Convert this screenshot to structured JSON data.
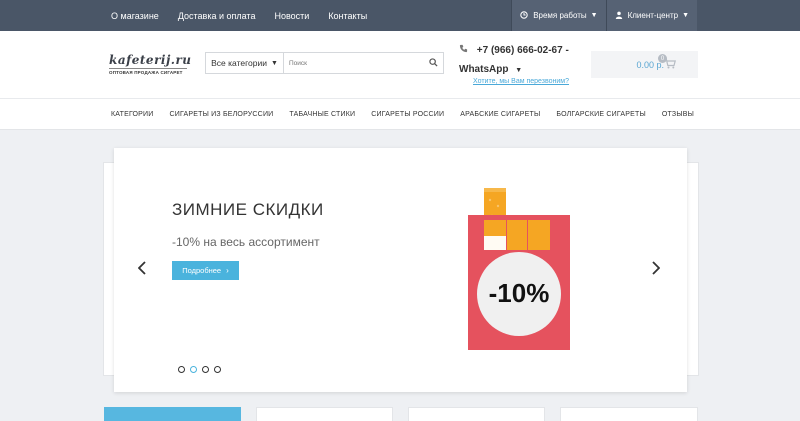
{
  "topbar": {
    "nav": [
      "О магазине",
      "Доставка и оплата",
      "Новости",
      "Контакты"
    ],
    "work_hours": "Время работы",
    "client_center": "Клиент-центр"
  },
  "header": {
    "logo_brand": "kafeterij.ru",
    "logo_sub": "ОПТОВАЯ ПРОДАЖА СИГАРЕТ",
    "search": {
      "category": "Все категории",
      "placeholder": "Поиск"
    },
    "phone": "+7 (966) 666-02-67 -",
    "whatsapp": "WhatsApp",
    "callback": "Хотите, мы Вам перезвоним?",
    "cart_total": "0.00 р.",
    "cart_count": "0"
  },
  "menu": {
    "items": [
      "КАТЕГОРИИ",
      "СИГАРЕТЫ ИЗ БЕЛОРУССИИ",
      "ТАБАЧНЫЕ СТИКИ",
      "СИГАРЕТЫ РОССИИ",
      "АРАБСКИЕ СИГАРЕТЫ",
      "БОЛГАРСКИЕ СИГАРЕТЫ",
      "ОТЗЫВЫ"
    ]
  },
  "slider": {
    "title": "ЗИМНИЕ СКИДКИ",
    "subtitle": "-10% на весь ассортимент",
    "button": "Подробнее",
    "discount": "-10%",
    "dots_count": 4,
    "active_dot": 1
  },
  "colors": {
    "topbar": "#4a5667",
    "accent": "#4ab3dd",
    "pack_red": "#e5525e",
    "pack_circle": "#f0f0f0",
    "cigarette_orange": "#f5a623"
  }
}
